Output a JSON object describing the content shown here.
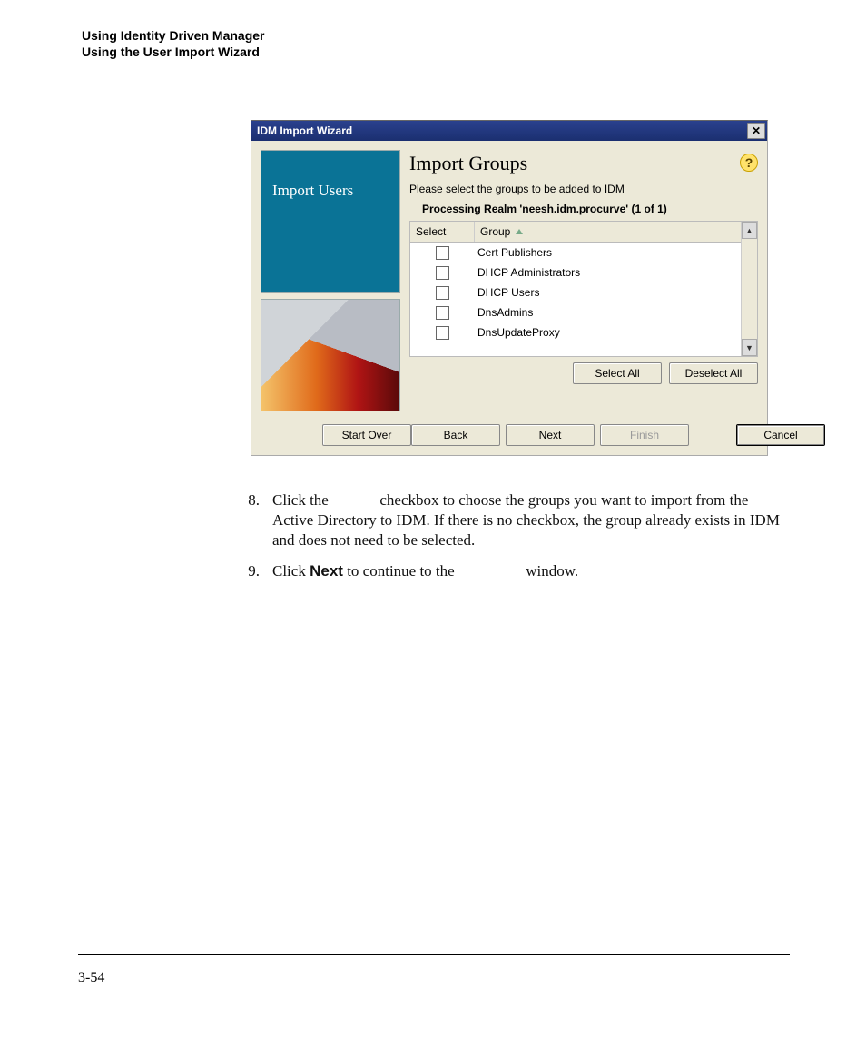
{
  "header": {
    "line1": "Using Identity Driven Manager",
    "line2": "Using the User Import Wizard"
  },
  "dialog": {
    "title": "IDM Import Wizard",
    "close_glyph": "✕",
    "side_label": "Import Users",
    "panel_title": "Import Groups",
    "help_glyph": "?",
    "hint": "Please select the groups to be added to IDM",
    "realm_text": "Processing Realm 'neesh.idm.procurve' (1 of 1)",
    "columns": {
      "select": "Select",
      "group": "Group"
    },
    "groups": [
      "Cert Publishers",
      "DHCP Administrators",
      "DHCP Users",
      "DnsAdmins",
      "DnsUpdateProxy"
    ],
    "scroll": {
      "up": "▲",
      "down": "▼"
    },
    "buttons": {
      "select_all": "Select All",
      "deselect_all": "Deselect All",
      "start_over": "Start Over",
      "back": "Back",
      "next": "Next",
      "finish": "Finish",
      "cancel": "Cancel"
    }
  },
  "instructions": {
    "step8_num": "8.",
    "step8_part1": "Click the ",
    "step8_part2": " checkbox to choose the groups you want to import from the Active Directory to IDM. If there is no checkbox, the group already exists in IDM and does not need to be selected.",
    "step9_num": "9.",
    "step9_part1": "Click ",
    "step9_bold": "Next",
    "step9_part2": " to continue to the ",
    "step9_part3": " window."
  },
  "page_number": "3-54"
}
